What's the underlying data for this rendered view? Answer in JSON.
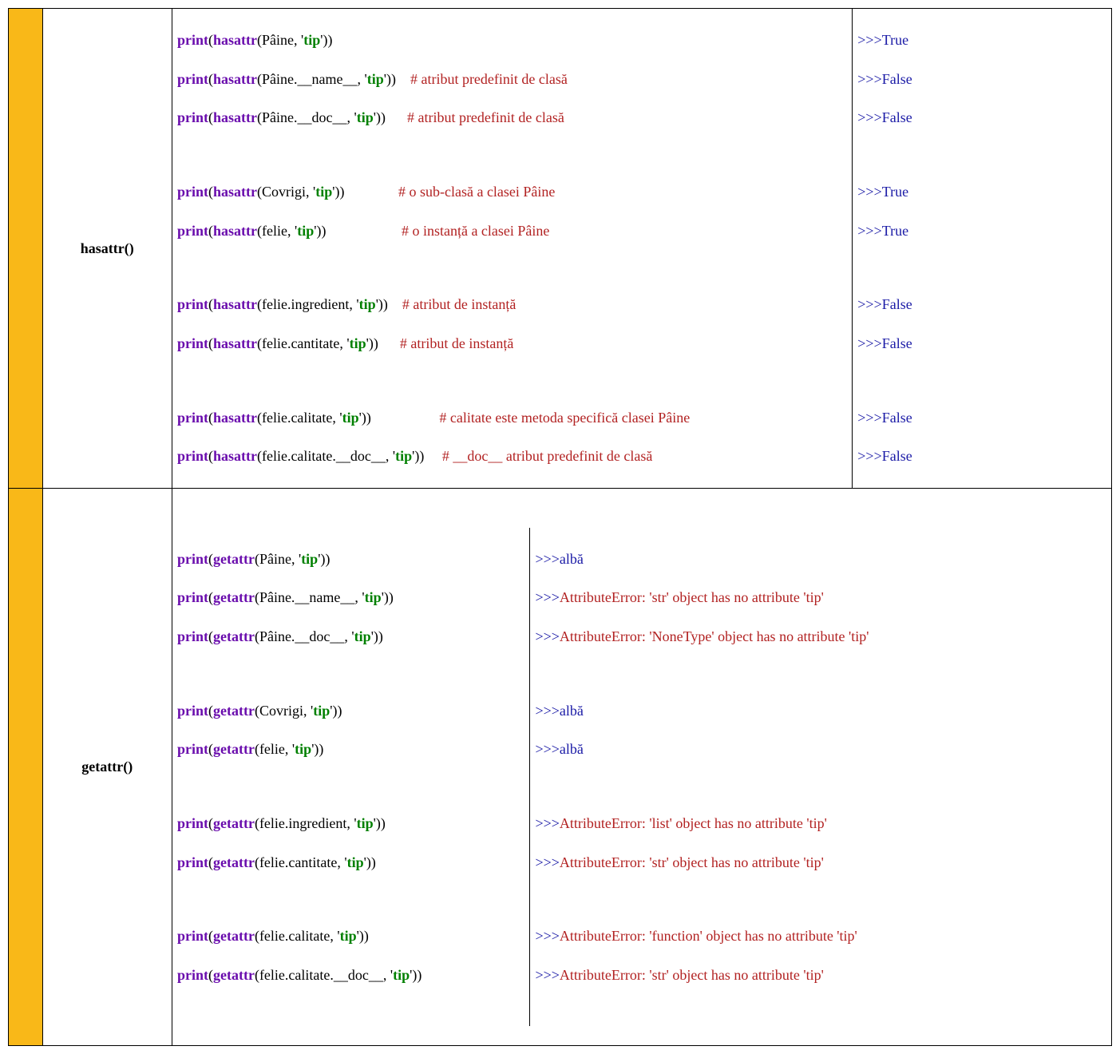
{
  "func1": "hasattr()",
  "func2": "getattr()",
  "kw_print": "print",
  "kw_hasattr": "hasattr",
  "kw_getattr": "getattr",
  "args": {
    "Paine": "Pâine",
    "Paine_name": "Pâine.__name__",
    "Paine_doc": "Pâine.__doc__",
    "Covrigi": "Covrigi",
    "felie": "felie",
    "felie_ingredient": "felie.ingredient",
    "felie_cantitate": "felie.cantitate",
    "felie_calitate": "felie.calitate",
    "felie_calitate_doc": "felie.calitate.__doc__"
  },
  "tip": "tip",
  "comments": {
    "c1": "# atribut predefinit de clasă",
    "c2": "# atribut predefinit de clasă",
    "c3": "# o sub-clasă a clasei Pâine",
    "c4": "# o instanță a clasei Pâine",
    "c5": "# atribut de instanță",
    "c6": "# atribut de instanță",
    "c7": "# calitate este metoda specifică clasei Pâine",
    "c8": "# __doc__ atribut predefinit de clasă"
  },
  "prompt": ">>>",
  "out1": {
    "r1": "True",
    "r2": "False",
    "r3": "False",
    "r4": "True",
    "r5": "True",
    "r6": "False",
    "r7": "False",
    "r8": "False",
    "r9": "False"
  },
  "out2": {
    "r1": "albă",
    "r2": "AttributeError: 'str' object has no attribute 'tip'",
    "r3": "AttributeError: 'NoneType' object has no attribute 'tip'",
    "r4": "albă",
    "r5": "albă",
    "r6": "AttributeError: 'list' object has no attribute 'tip'",
    "r7": "AttributeError: 'str' object has no attribute 'tip'",
    "r8": "AttributeError: 'function' object has no attribute 'tip'",
    "r9": "AttributeError: 'str' object has no attribute 'tip'"
  }
}
